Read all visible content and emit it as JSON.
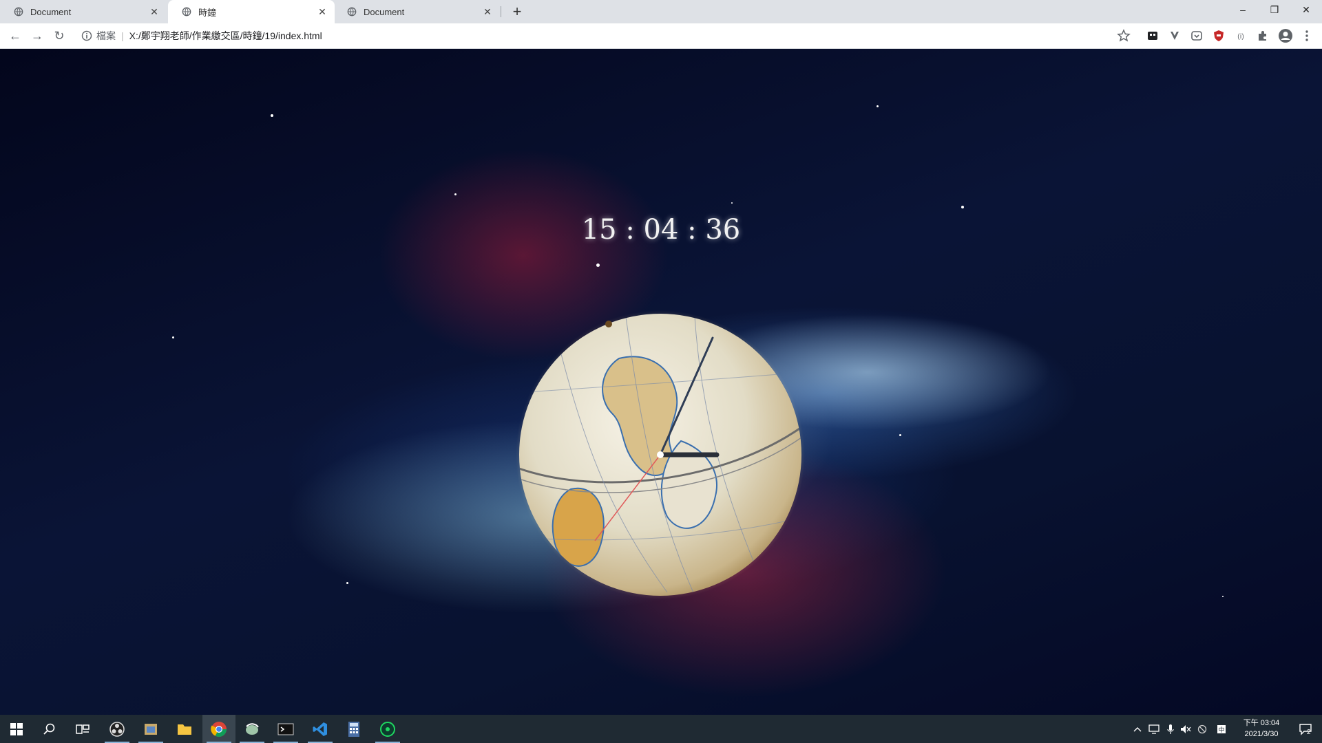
{
  "browser": {
    "tabs": [
      {
        "title": "Document",
        "active": false
      },
      {
        "title": "時鐘",
        "active": true
      },
      {
        "title": "Document",
        "active": false
      }
    ],
    "new_tab_label": "+",
    "window_controls": {
      "minimize": "–",
      "restore": "❐",
      "close": "✕"
    },
    "nav": {
      "back": "←",
      "forward": "→",
      "reload": "↻"
    },
    "address": {
      "scheme_label": "檔案",
      "separator": "|",
      "url": "X:/鄭宇翔老師/作業繳交區/時鐘/19/index.html"
    },
    "extension_icons": [
      "extension-box-icon",
      "vpn-icon",
      "pocket-icon",
      "ublock-icon",
      "cast-icon",
      "puzzle-icon",
      "profile-icon",
      "menu-icon"
    ]
  },
  "page": {
    "digital_clock": "15 : 04 : 36"
  },
  "taskbar": {
    "apps": [
      "start-icon",
      "search-icon",
      "task-view-icon",
      "obs-icon",
      "file-manager-icon",
      "folder-icon",
      "chrome-icon",
      "mail-icon",
      "terminal-icon",
      "vscode-icon",
      "calculator-icon",
      "music-icon"
    ],
    "tray": {
      "time": "下午 03:04",
      "date": "2021/3/30",
      "notifications": "2"
    }
  },
  "colors": {
    "tabstrip": "#dee1e6",
    "taskbar": "#1f2a33",
    "clock_text": "#f2f2f2"
  }
}
